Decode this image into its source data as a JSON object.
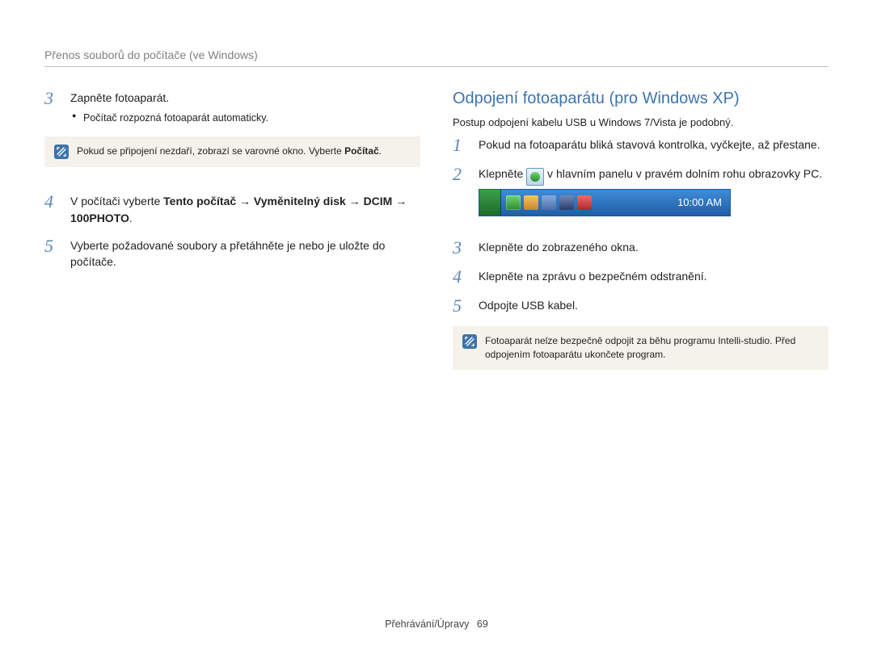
{
  "header": {
    "title": "Přenos souborů do počítače (ve Windows)"
  },
  "left": {
    "step3": {
      "num": "3",
      "title": "Zapněte fotoaparát.",
      "bullet1": "Počítač rozpozná fotoaparát automaticky."
    },
    "note1": {
      "line1": "Pokud se připojení nezdaří, zobrazí se varovné okno. Vyberte ",
      "bold": "Počítač",
      "suffix": "."
    },
    "step4": {
      "num": "4",
      "prefix": "V počítači vyberte ",
      "b1": "Tento počítač",
      "arrow1": " → ",
      "b2": "Vyměnitelný disk",
      "arrow2": " → ",
      "b3": "DCIM",
      "arrow3": " → ",
      "b4": "100PHOTO",
      "suffix": "."
    },
    "step5": {
      "num": "5",
      "text": "Vyberte požadované soubory a přetáhněte je nebo je uložte do počítače."
    }
  },
  "right": {
    "title": "Odpojení fotoaparátu (pro Windows XP)",
    "intro": "Postup odpojení kabelu USB u Windows 7/Vista je podobný.",
    "step1": {
      "num": "1",
      "text": "Pokud na fotoaparátu bliká stavová kontrolka, vyčkejte, až přestane."
    },
    "step2": {
      "num": "2",
      "pre": "Klepněte ",
      "post": " v hlavním panelu v pravém dolním rohu obrazovky PC."
    },
    "taskbar_time": "10:00 AM",
    "step3": {
      "num": "3",
      "text": "Klepněte do zobrazeného okna."
    },
    "step4": {
      "num": "4",
      "text": "Klepněte na zprávu o bezpečném odstranění."
    },
    "step5": {
      "num": "5",
      "text": "Odpojte USB kabel."
    },
    "note2": {
      "line1": "Fotoaparát nelze bezpečně odpojit za běhu programu Intelli-studio. Před odpojením fotoaparátu ukončete program."
    }
  },
  "footer": {
    "section": "Přehrávání/Úpravy",
    "page": "69"
  }
}
